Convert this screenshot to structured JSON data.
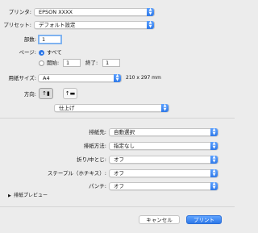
{
  "printer": {
    "label": "プリンタ:",
    "value": "EPSON XXXX"
  },
  "preset": {
    "label": "プリセット:",
    "value": "デフォルト設定"
  },
  "copies": {
    "label": "部数:",
    "value": "1"
  },
  "pages": {
    "label": "ページ:",
    "all_label": "すべて",
    "from_label": "開始:",
    "from_value": "1",
    "to_label": "終了:",
    "to_value": "1"
  },
  "paper_size": {
    "label": "用紙サイズ:",
    "value": "A4",
    "dimensions": "210 x 297 mm"
  },
  "orientation": {
    "label": "方向:"
  },
  "section": {
    "value": "仕上げ"
  },
  "finishing": {
    "output_tray": {
      "label": "排紙先:",
      "value": "自動選択"
    },
    "output_method": {
      "label": "排紙方法:",
      "value": "指定なし"
    },
    "fold": {
      "label": "折り/中とじ:",
      "value": "オフ"
    },
    "staple": {
      "label": "ステープル（ホチキス）:",
      "value": "オフ"
    },
    "punch": {
      "label": "パンチ:",
      "value": "オフ"
    }
  },
  "preview_toggle": {
    "label": "排紙プレビュー"
  },
  "buttons": {
    "cancel": "キャンセル",
    "print": "プリント"
  },
  "colors": {
    "accent": "#2f79e8",
    "background": "#ececec"
  }
}
